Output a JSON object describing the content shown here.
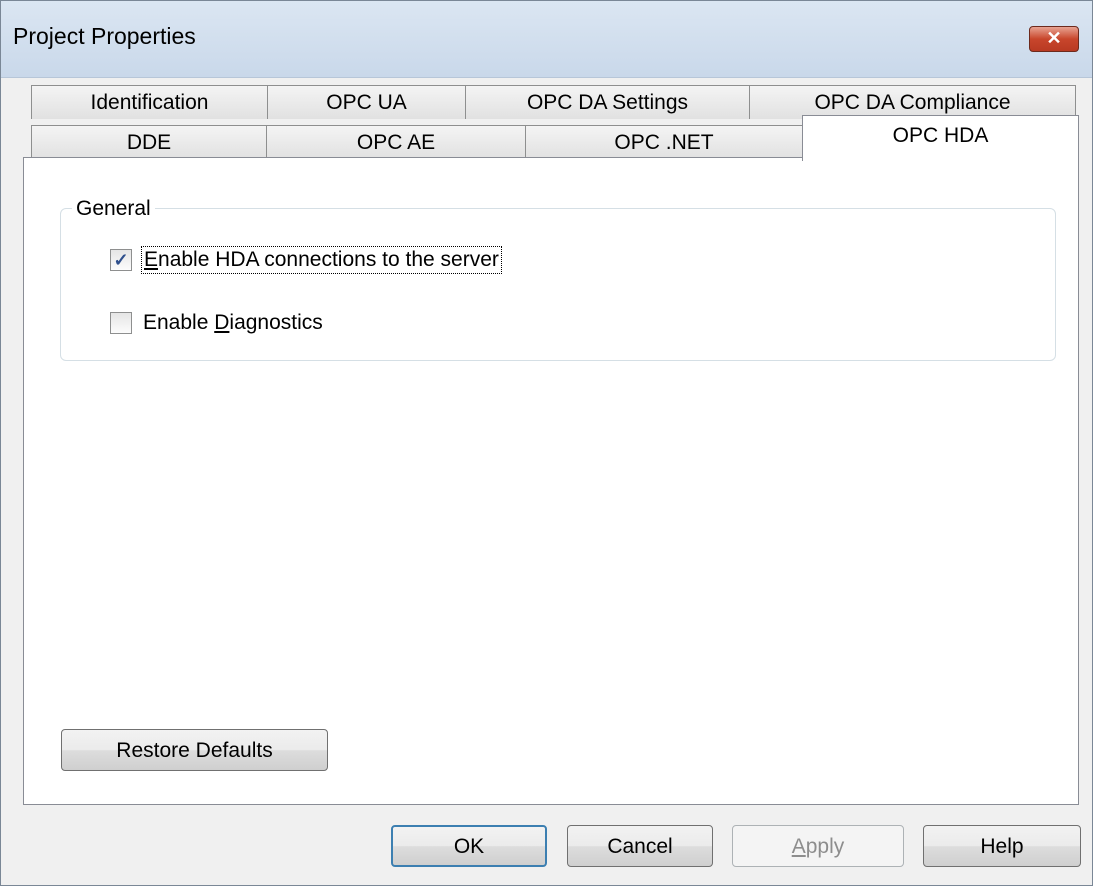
{
  "window": {
    "title": "Project Properties",
    "close_glyph": "✕"
  },
  "tabs": {
    "back_row": [
      {
        "label": "Identification"
      },
      {
        "label": "OPC UA"
      },
      {
        "label": "OPC DA Settings"
      },
      {
        "label": "OPC DA Compliance"
      }
    ],
    "front_row": [
      {
        "label": "DDE"
      },
      {
        "label": "OPC AE"
      },
      {
        "label": "OPC .NET"
      },
      {
        "label": "OPC HDA",
        "active": true
      }
    ]
  },
  "general": {
    "legend": "General",
    "options": [
      {
        "label_prefix": "",
        "mnemonic": "E",
        "label_rest": "nable HDA connections to the server",
        "checked": true
      },
      {
        "label_prefix": "Enable ",
        "mnemonic": "D",
        "label_rest": "iagnostics",
        "checked": false
      }
    ]
  },
  "restore_defaults_label": "Restore Defaults",
  "footer": {
    "ok": "OK",
    "cancel": "Cancel",
    "apply_mnemonic": "A",
    "apply_rest": "pply",
    "help": "Help"
  },
  "icons": {
    "checkmark": "✓"
  }
}
